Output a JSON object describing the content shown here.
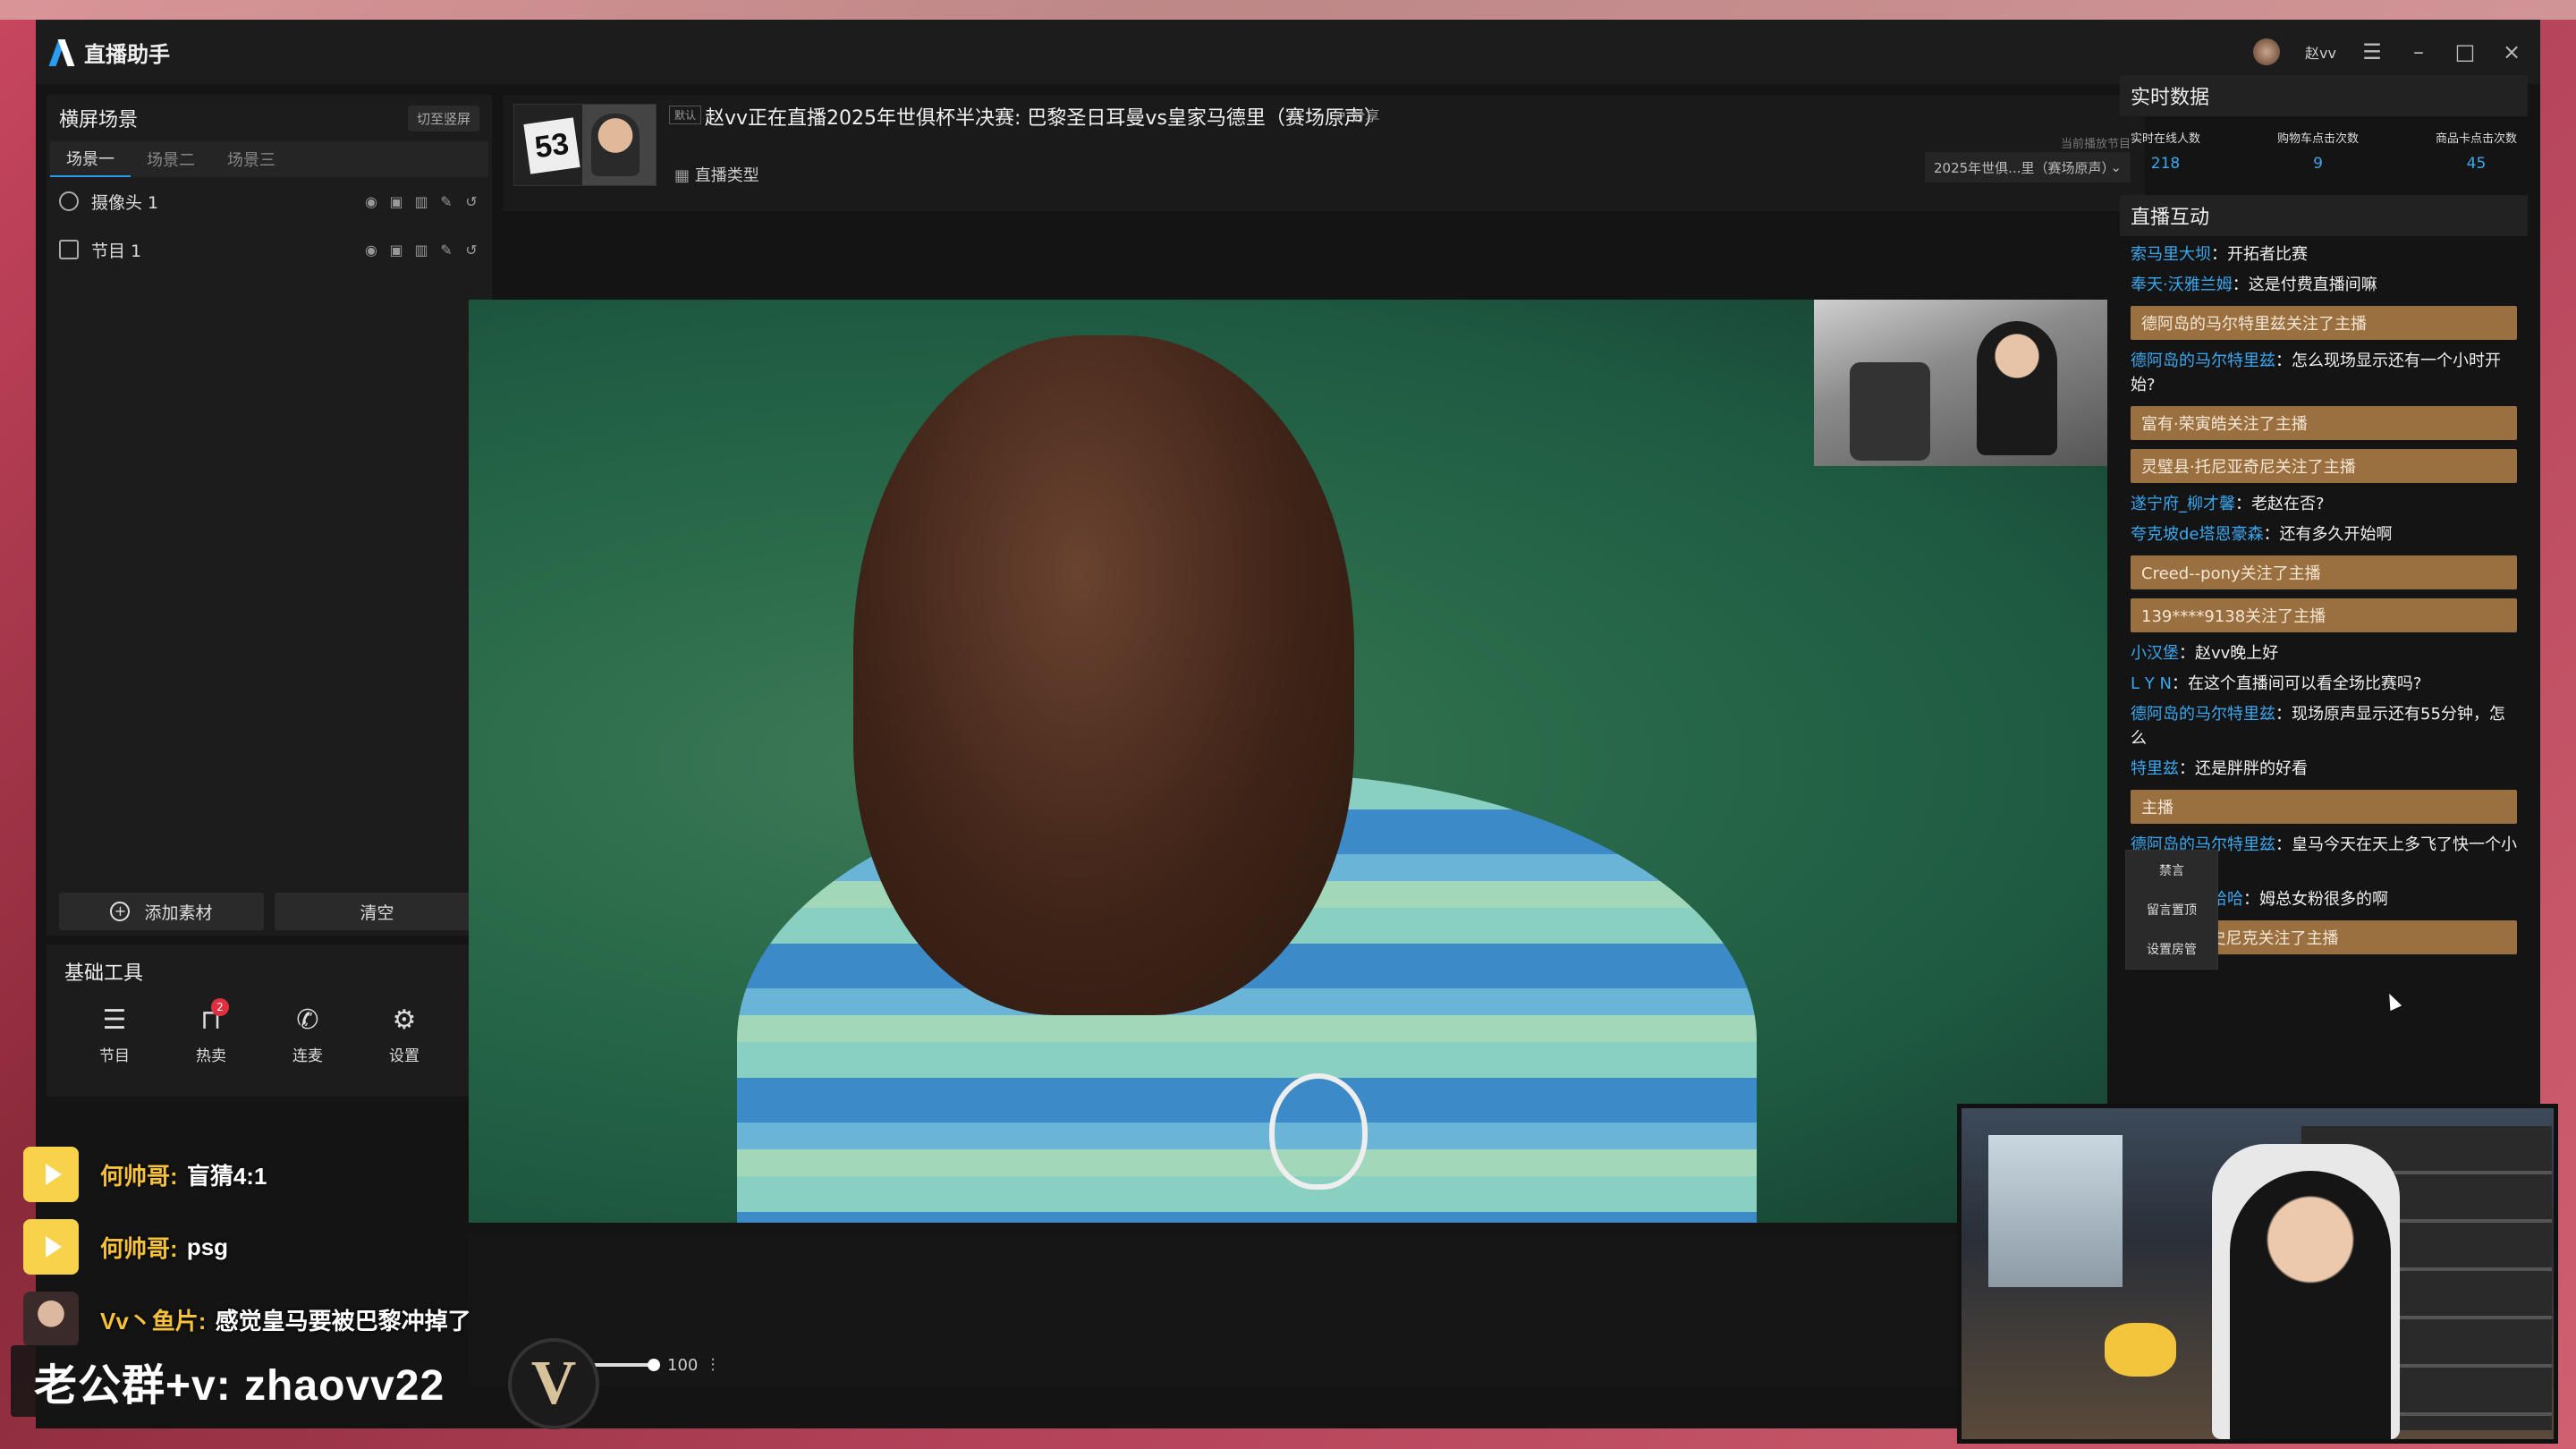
{
  "app": {
    "title": "直播助手",
    "user_name": "赵vv"
  },
  "left_panel": {
    "title": "横屏场景",
    "switch_label": "切至竖屏",
    "scene_tabs": [
      "场景一",
      "场景二",
      "场景三"
    ],
    "sources": [
      {
        "label": "摄像头 1",
        "icon": "location-pin-icon"
      },
      {
        "label": "节目 1",
        "icon": "tv-icon"
      }
    ],
    "add_button": "添加素材",
    "clear_button": "清空"
  },
  "tools": {
    "title": "基础工具",
    "items": [
      {
        "label": "节目",
        "icon": "list-icon"
      },
      {
        "label": "热卖",
        "icon": "bag-icon",
        "badge": "2"
      },
      {
        "label": "连麦",
        "icon": "phone-icon"
      },
      {
        "label": "设置",
        "icon": "gear-icon"
      }
    ]
  },
  "stream": {
    "default_tag": "默认",
    "title": "赵vv正在直播2025年世俱杯半决赛: 巴黎圣日耳曼vs皇家马德里（赛场原声）",
    "share_label": "分享",
    "type_label": "直播类型",
    "now_playing_label": "当前播放节目",
    "program_select": "2025年世俱...里（赛场原声）"
  },
  "volume": {
    "value": "100"
  },
  "stats": {
    "title": "实时数据",
    "items": [
      {
        "label": "实时在线人数",
        "value": "218"
      },
      {
        "label": "购物车点击次数",
        "value": "9"
      },
      {
        "label": "商品卡点击次数",
        "value": "45"
      }
    ]
  },
  "chat": {
    "title": "直播互动",
    "messages": [
      {
        "type": "msg",
        "nick": "索马里大坝",
        "text": "开拓者比赛"
      },
      {
        "type": "msg",
        "nick": "奉天·沃雅兰姆",
        "text": "这是付费直播间嘛"
      },
      {
        "type": "follow",
        "text": "德阿岛的马尔特里兹关注了主播"
      },
      {
        "type": "msg",
        "nick": "德阿岛的马尔特里兹",
        "text": "怎么现场显示还有一个小时开始?"
      },
      {
        "type": "follow",
        "text": "富有·荣寅皓关注了主播"
      },
      {
        "type": "follow",
        "text": "灵璧县·托尼亚奇尼关注了主播"
      },
      {
        "type": "msg",
        "nick": "遂宁府_柳才馨",
        "text": "老赵在否?"
      },
      {
        "type": "msg",
        "nick": "夸克坡de塔恩豪森",
        "text": "还有多久开始啊"
      },
      {
        "type": "follow",
        "text": "Creed--pony关注了主播"
      },
      {
        "type": "follow",
        "text": "139****9138关注了主播"
      },
      {
        "type": "msg",
        "nick": "小汉堡",
        "text": "赵vv晚上好"
      },
      {
        "type": "msg",
        "nick": "L Y N",
        "text": "在这个直播间可以看全场比赛吗?"
      },
      {
        "type": "msg",
        "nick": "德阿岛的马尔特里兹",
        "text": "现场原声显示还有55分钟，怎么"
      },
      {
        "type": "msg",
        "nick": "特里兹",
        "text": "还是胖胖的好看"
      },
      {
        "type": "follow",
        "text": "主播"
      },
      {
        "type": "msg",
        "nick": "德阿岛的马尔特里兹",
        "text": "皇马今天在天上多飞了快一个小时"
      },
      {
        "type": "msg",
        "nick": "哈哈哈哈哈哈哈",
        "text": "姆总女粉很多的啊"
      },
      {
        "type": "follow",
        "text": "莫利谷de史尼克关注了主播"
      }
    ],
    "context_menu": [
      "禁言",
      "留言置顶",
      "设置房管"
    ]
  },
  "overlay": {
    "danmaku": [
      {
        "name": "何帅哥:",
        "text": "盲猜4:1"
      },
      {
        "name": "何帅哥:",
        "text": "psg"
      },
      {
        "name": "Vv丶鱼片:",
        "text": "感觉皇马要被巴黎冲掉了"
      }
    ],
    "wechat": "老公群+v: zhaovv22",
    "logo_letter": "V"
  }
}
